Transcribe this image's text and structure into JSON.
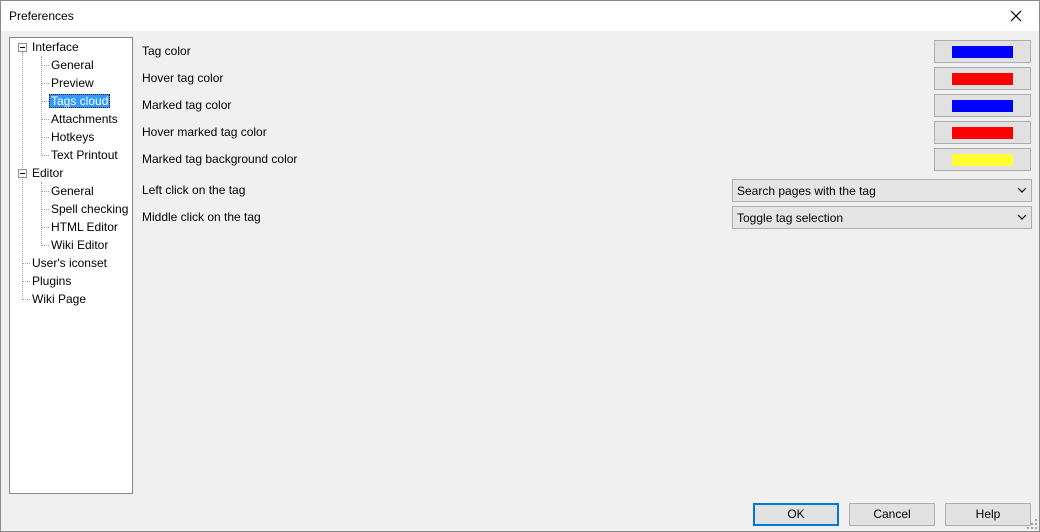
{
  "window": {
    "title": "Preferences"
  },
  "tree": {
    "items": [
      {
        "label": "Interface",
        "level": 0,
        "expanded": true
      },
      {
        "label": "General",
        "level": 1
      },
      {
        "label": "Preview",
        "level": 1
      },
      {
        "label": "Tags cloud",
        "level": 1,
        "selected": true
      },
      {
        "label": "Attachments",
        "level": 1
      },
      {
        "label": "Hotkeys",
        "level": 1
      },
      {
        "label": "Text Printout",
        "level": 1
      },
      {
        "label": "Editor",
        "level": 0,
        "expanded": true
      },
      {
        "label": "General",
        "level": 1
      },
      {
        "label": "Spell checking",
        "level": 1
      },
      {
        "label": "HTML Editor",
        "level": 1
      },
      {
        "label": "Wiki Editor",
        "level": 1
      },
      {
        "label": "User's iconset",
        "level": 0
      },
      {
        "label": "Plugins",
        "level": 0
      },
      {
        "label": "Wiki Page",
        "level": 0
      }
    ]
  },
  "settings": {
    "tag_color": {
      "label": "Tag color",
      "color": "#0000ff"
    },
    "hover_tag_color": {
      "label": "Hover tag color",
      "color": "#ff0000"
    },
    "marked_tag_color": {
      "label": "Marked tag color",
      "color": "#0000ff"
    },
    "hover_marked_tag_color": {
      "label": "Hover marked tag color",
      "color": "#ff0000"
    },
    "marked_tag_bg_color": {
      "label": "Marked tag background color",
      "color": "#ffff33"
    },
    "left_click": {
      "label": "Left click on the tag",
      "value": "Search pages with the tag"
    },
    "middle_click": {
      "label": "Middle click on the tag",
      "value": "Toggle tag selection"
    }
  },
  "buttons": {
    "ok": "OK",
    "cancel": "Cancel",
    "help": "Help"
  },
  "icons": {
    "close": "close-icon",
    "expander": "minus-box-icon",
    "dropdown": "chevron-down-icon",
    "grip": "resize-grip-icon"
  }
}
